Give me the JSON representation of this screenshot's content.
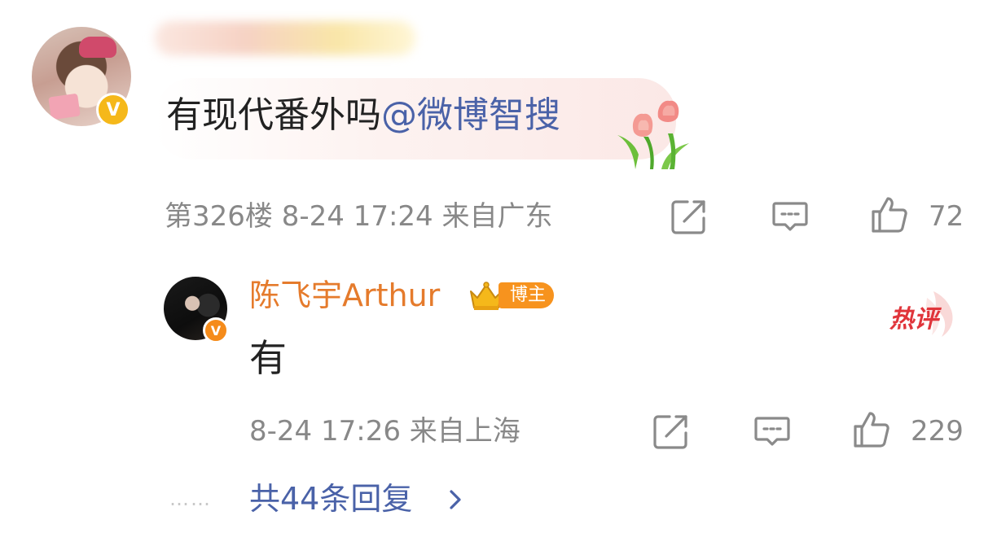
{
  "comment": {
    "text": "有现代番外吗",
    "mention": "@微博智搜",
    "floor": "第326楼",
    "time": "8-24 17:24",
    "location": "来自广东",
    "likes": "72",
    "verified_badge": "V"
  },
  "reply": {
    "author": "陈飞宇Arthur",
    "author_tag": "博主",
    "hot_badge": "热评",
    "text": "有",
    "time": "8-24 17:26",
    "location": "来自上海",
    "likes": "229",
    "verified_badge": "V"
  },
  "more_replies": {
    "dots": "……",
    "label": "共44条回复"
  },
  "icons": {
    "share": "share-icon",
    "comment": "comment-icon",
    "like": "thumbs-up-icon",
    "chevron": "chevron-right-icon"
  },
  "colors": {
    "mention": "#4a62a8",
    "author_name": "#e57b2c",
    "author_tag_bg": "#f7931e",
    "hot_badge": "#e0353b",
    "meta": "#888888",
    "verified": "#f5b81a"
  }
}
